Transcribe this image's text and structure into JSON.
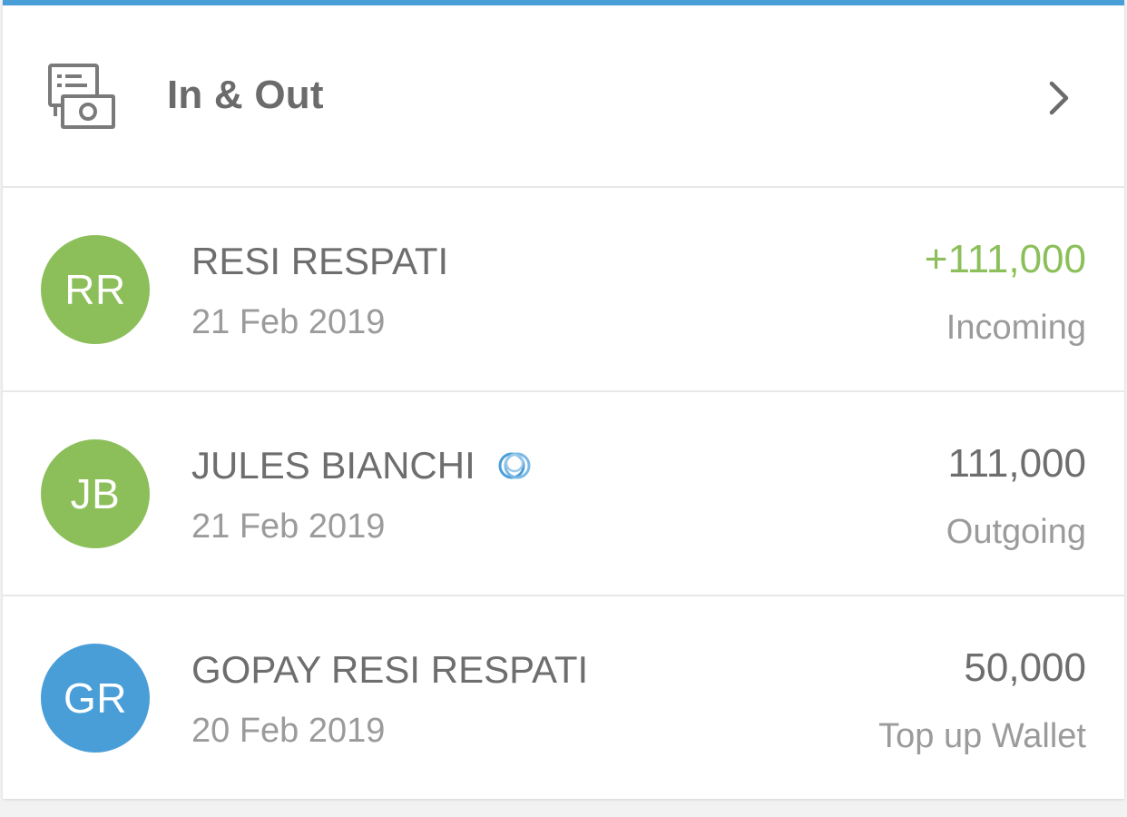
{
  "header": {
    "title": "In & Out",
    "icon": "transactions-icon"
  },
  "transactions": [
    {
      "initials": "RR",
      "name": "RESI RESPATI",
      "date": "21 Feb 2019",
      "amount": "+111,000",
      "type": "Incoming",
      "avatar_color": "#8cbf5a",
      "amount_color": "#8cbf5a"
    },
    {
      "initials": "JB",
      "name": "JULES BIANCHI",
      "date": "21 Feb 2019",
      "amount": "111,000",
      "type": "Outgoing",
      "avatar_color": "#8cbf5a",
      "badge_icon": "recurring-loop-icon"
    },
    {
      "initials": "GR",
      "name": "GOPAY RESI RESPATI",
      "date": "20 Feb 2019",
      "amount": "50,000",
      "type": "Top up Wallet",
      "avatar_color": "#4a9ed8"
    }
  ],
  "colors": {
    "accent": "#4a9ed8",
    "incoming": "#8cbf5a",
    "text_primary": "#6e6e6e",
    "text_secondary": "#9b9b9b"
  }
}
